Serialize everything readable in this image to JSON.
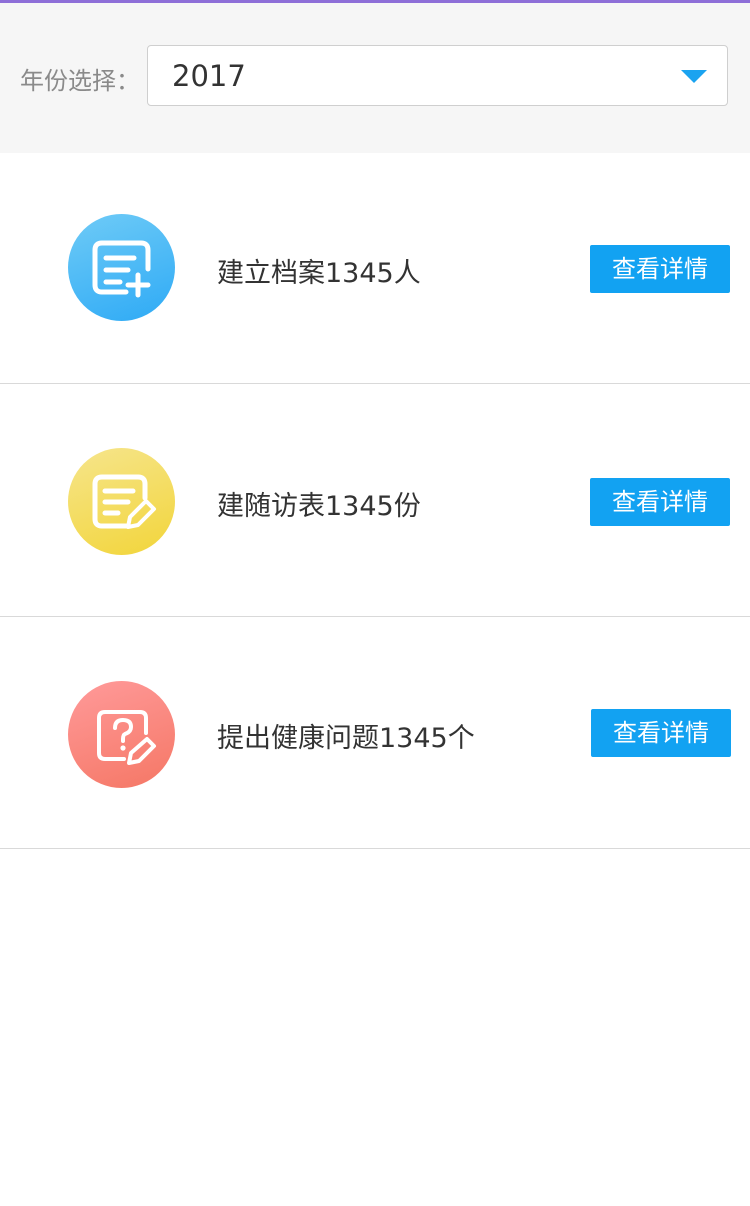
{
  "filter": {
    "label": "年份选择：",
    "selected_year": "2017"
  },
  "items": [
    {
      "text": "建立档案1345人",
      "button": "查看详情",
      "icon": "document-add-icon",
      "color": "#2eaaf5"
    },
    {
      "text": "建随访表1345份",
      "button": "查看详情",
      "icon": "document-edit-icon",
      "color": "#f2d53a"
    },
    {
      "text": "提出健康问题1345个",
      "button": "查看详情",
      "icon": "question-edit-icon",
      "color": "#f57765"
    }
  ],
  "colors": {
    "accent": "#12a2f2",
    "top_bar": "#8e6fd8"
  }
}
